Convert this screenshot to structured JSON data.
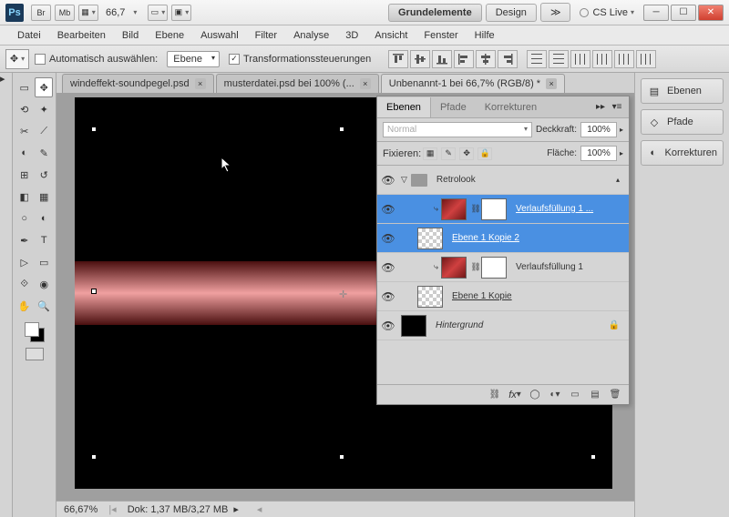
{
  "titlebar": {
    "ps": "Ps",
    "br": "Br",
    "mb": "Mb",
    "zoom": "66,7",
    "workspace_main": "Grundelemente",
    "workspace_design": "Design",
    "cslive": "CS Live"
  },
  "menu": [
    "Datei",
    "Bearbeiten",
    "Bild",
    "Ebene",
    "Auswahl",
    "Filter",
    "Analyse",
    "3D",
    "Ansicht",
    "Fenster",
    "Hilfe"
  ],
  "options": {
    "autoselect": "Automatisch auswählen:",
    "layer": "Ebene",
    "transform": "Transformationssteuerungen"
  },
  "doctabs": [
    {
      "name": "windeffekt-soundpegel.psd",
      "x": "×",
      "active": false
    },
    {
      "name": "musterdatei.psd bei 100% (...",
      "x": "×",
      "active": false
    },
    {
      "name": "Unbenannt-1 bei 66,7% (RGB/8) *",
      "x": "×",
      "active": true
    }
  ],
  "panel": {
    "tabs": {
      "ebenen": "Ebenen",
      "pfade": "Pfade",
      "korrekturen": "Korrekturen"
    },
    "blend": "Normal",
    "opacity_label": "Deckkraft:",
    "opacity": "100%",
    "lock_label": "Fixieren:",
    "fill_label": "Fläche:",
    "fill": "100%",
    "group": "Retrolook",
    "layers": [
      {
        "name": "Verlaufsfüllung 1 ...",
        "type": "fill",
        "sel": true,
        "indent": 2,
        "ul": true
      },
      {
        "name": "Ebene 1 Kopie 2",
        "type": "layer",
        "sel": true,
        "indent": 1,
        "ul": true
      },
      {
        "name": "Verlaufsfüllung 1",
        "type": "fill",
        "sel": false,
        "indent": 2,
        "ul": false
      },
      {
        "name": "Ebene 1 Kopie",
        "type": "layer",
        "sel": false,
        "indent": 1,
        "ul": true
      },
      {
        "name": "Hintergrund",
        "type": "bg",
        "sel": false,
        "indent": 0,
        "ul": false
      }
    ]
  },
  "dock": {
    "ebenen": "Ebenen",
    "pfade": "Pfade",
    "korrekturen": "Korrekturen"
  },
  "status": {
    "zoom": "66,67%",
    "doc": "Dok: 1,37 MB/3,27 MB"
  }
}
